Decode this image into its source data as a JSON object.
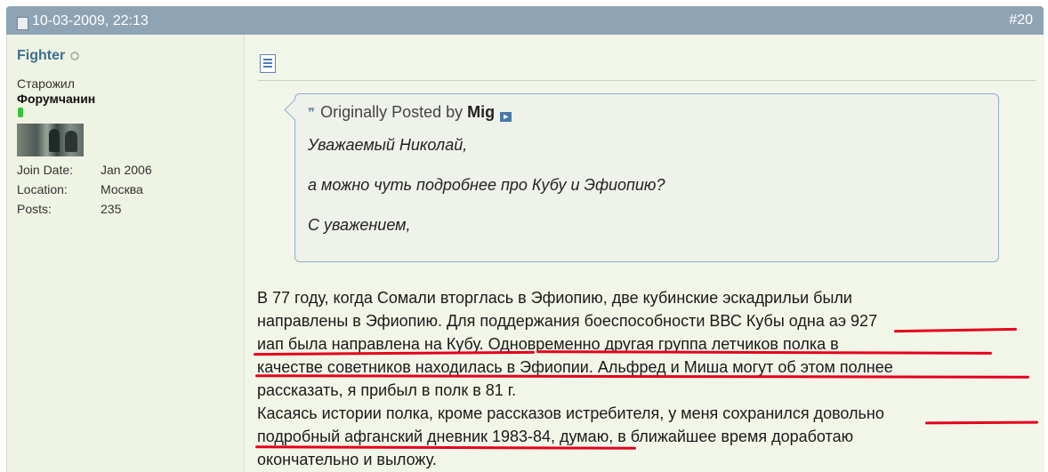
{
  "post": {
    "date": "10-03-2009, 22:13",
    "number": "#20"
  },
  "user": {
    "name": "Fighter",
    "title": "Старожил",
    "rank": "Форумчанин",
    "stats": [
      {
        "label": "Join Date:",
        "value": "Jan 2006"
      },
      {
        "label": "Location:",
        "value": "Москва"
      },
      {
        "label": "Posts:",
        "value": "235"
      }
    ]
  },
  "quote": {
    "prefix": "Originally Posted by",
    "author": "Mig",
    "lines": [
      "Уважаемый Николай,",
      "а можно чуть подробнее про Кубу и Эфиопию?",
      "С уважением,"
    ]
  },
  "message": {
    "lines": [
      "В 77 году, когда Сомали вторглась в Эфиопию, две кубинские эскадрильи были",
      "направлены в Эфиопию. Для поддержания боеспособности ВВС Кубы одна аэ 927",
      "иап была направлена на Кубу. Одновременно другая группа летчиков полка в",
      "качестве советников находилась в Эфиопии. Альфред и Миша могут об этом полнее",
      "рассказать, я прибыл в полк в 81 г.",
      "Касаясь истории полка, кроме рассказов истребителя, у меня сохранился довольно",
      "подробный афганский дневник 1983-84, думаю, в ближайшее время доработаю",
      "окончательно и выложу."
    ]
  },
  "colors": {
    "header": "#8ea3b4",
    "username": "#3e6e8e",
    "underline": "#e4001b",
    "background": "#f2f6e8"
  }
}
